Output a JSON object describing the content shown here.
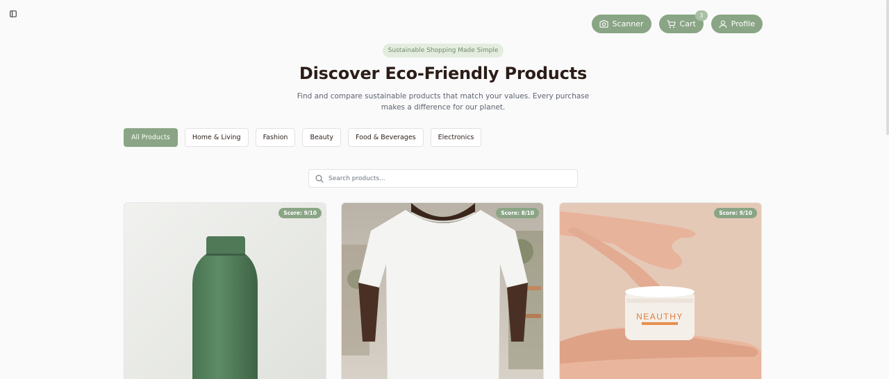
{
  "header": {
    "nav": {
      "scanner_label": "Scanner",
      "cart_label": "Cart",
      "cart_count": "3",
      "profile_label": "Profile"
    }
  },
  "hero": {
    "tagline": "Sustainable Shopping Made Simple",
    "title": "Discover Eco-Friendly Products",
    "subtitle": "Find and compare sustainable products that match your values. Every purchase makes a difference for our planet."
  },
  "filters": [
    {
      "label": "All Products",
      "active": true
    },
    {
      "label": "Home & Living",
      "active": false
    },
    {
      "label": "Fashion",
      "active": false
    },
    {
      "label": "Beauty",
      "active": false
    },
    {
      "label": "Food & Beverages",
      "active": false
    },
    {
      "label": "Electronics",
      "active": false
    }
  ],
  "search": {
    "placeholder": "Search products...",
    "value": ""
  },
  "products": [
    {
      "image": "green water bottle",
      "score": "Score: 9/10"
    },
    {
      "image": "white t-shirt",
      "score": "Score: 8/10"
    },
    {
      "image": "cream jar in hand",
      "score": "Score: 9/10",
      "jar_brand": "NEAUTHY"
    }
  ],
  "colors": {
    "accent": "#8aa585",
    "accent_light": "#e3ecdf",
    "title": "#2b1d17",
    "background": "#fafafa"
  },
  "icons": {
    "sidebar_toggle": "sidebar-toggle-icon",
    "scanner": "camera-icon",
    "cart": "cart-icon",
    "profile": "user-icon",
    "search": "search-icon"
  }
}
